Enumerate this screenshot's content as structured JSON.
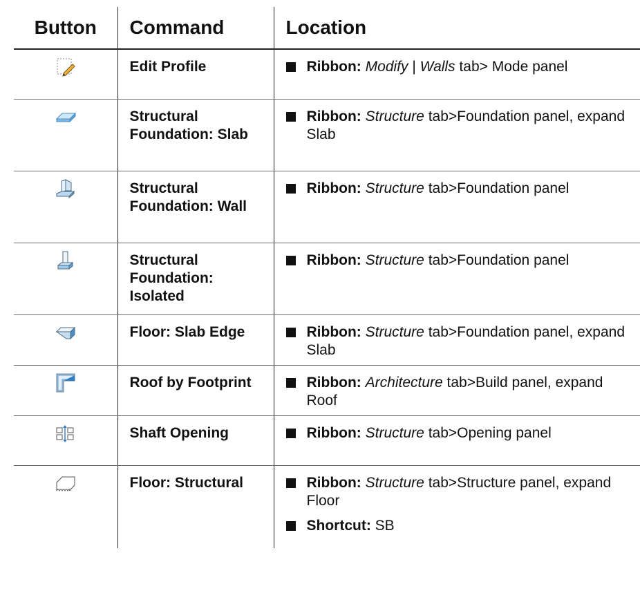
{
  "header": {
    "button": "Button",
    "command": "Command",
    "location": "Location"
  },
  "rows": [
    {
      "icon": "edit-profile-icon",
      "command": "Edit Profile",
      "height": 72,
      "locations": [
        {
          "label": "Ribbon:",
          "ital": "Modify",
          "rest": " | ",
          "ital2": "Walls",
          "rest2": " tab> Mode panel"
        }
      ]
    },
    {
      "icon": "slab-foundation-icon",
      "command": "Structural Foundation: Slab",
      "height": 104,
      "locations": [
        {
          "label": "Ribbon:",
          "ital": "Structure",
          "rest": " tab>Foundation panel, expand Slab"
        }
      ]
    },
    {
      "icon": "wall-foundation-icon",
      "command": "Structural Foundation: Wall",
      "height": 104,
      "locations": [
        {
          "label": "Ribbon:",
          "ital": "Structure",
          "rest": " tab>Foundation panel"
        }
      ]
    },
    {
      "icon": "isolated-foundation-icon",
      "command": "Structural Foundation: Isolated",
      "height": 104,
      "locations": [
        {
          "label": "Ribbon:",
          "ital": "Structure",
          "rest": " tab>Foundation panel"
        }
      ]
    },
    {
      "icon": "slab-edge-icon",
      "command": "Floor: Slab Edge",
      "height": 72,
      "locations": [
        {
          "label": "Ribbon:",
          "ital": "Structure",
          "rest": " tab>Foundation panel, expand Slab"
        }
      ]
    },
    {
      "icon": "roof-footprint-icon",
      "command": "Roof by Footprint",
      "height": 72,
      "locations": [
        {
          "label": "Ribbon:",
          "ital": "Architecture",
          "rest": " tab>Build panel, expand Roof"
        }
      ]
    },
    {
      "icon": "shaft-opening-icon",
      "command": "Shaft Opening",
      "height": 72,
      "locations": [
        {
          "label": "Ribbon:",
          "ital": "Structure",
          "rest": " tab>Opening panel"
        }
      ]
    },
    {
      "icon": "structural-floor-icon",
      "command": "Floor: Structural",
      "height": 120,
      "locations": [
        {
          "label": "Ribbon:",
          "ital": "Structure",
          "rest": " tab>Structure panel, expand Floor"
        },
        {
          "label": "Shortcut:",
          "ital": "",
          "rest": " SB"
        }
      ]
    }
  ]
}
